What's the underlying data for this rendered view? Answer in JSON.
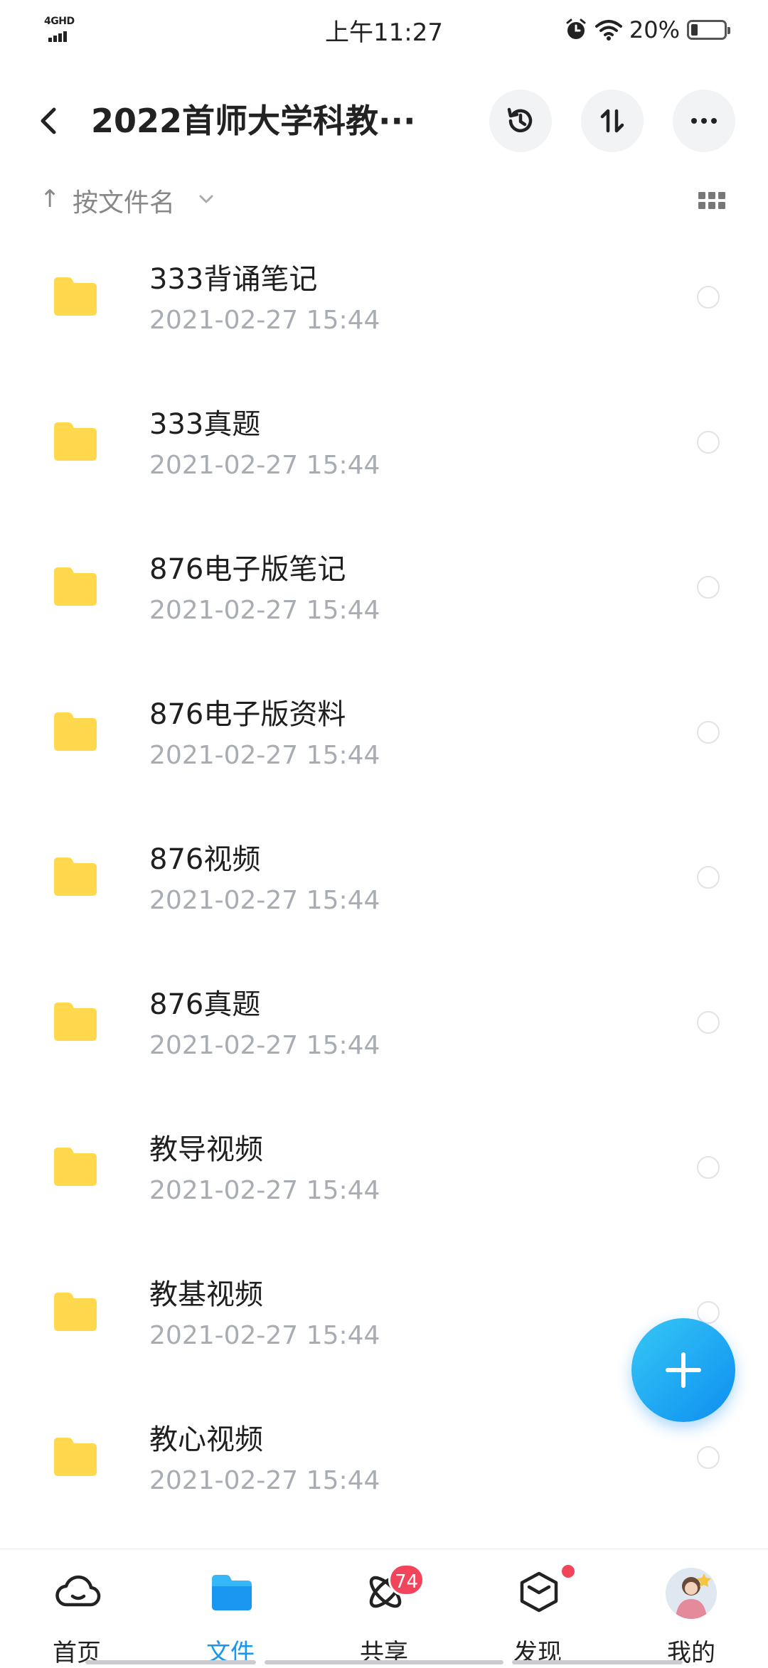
{
  "status_bar": {
    "network": "4GHD",
    "time": "上午11:27",
    "battery": "20%",
    "battery_level": 0.2
  },
  "header": {
    "title": "2022首师大学科教···",
    "back_icon": "back-arrow-icon",
    "history_icon": "history-clock-icon",
    "transfer_icon": "up-down-transfer-icon",
    "more_icon": "more-dots-icon"
  },
  "sort": {
    "label": "按文件名",
    "arrow_icon": "sort-up-arrow-icon",
    "view_icon": "grid-view-icon"
  },
  "files": [
    {
      "name": "333背诵笔记",
      "date": "2021-02-27  15:44"
    },
    {
      "name": "333真题",
      "date": "2021-02-27  15:44"
    },
    {
      "name": "876电子版笔记",
      "date": "2021-02-27  15:44"
    },
    {
      "name": "876电子版资料",
      "date": "2021-02-27  15:44"
    },
    {
      "name": "876视频",
      "date": "2021-02-27  15:44"
    },
    {
      "name": "876真题",
      "date": "2021-02-27  15:44"
    },
    {
      "name": "教导视频",
      "date": "2021-02-27  15:44"
    },
    {
      "name": "教基视频",
      "date": "2021-02-27  15:44"
    },
    {
      "name": "教心视频",
      "date": "2021-02-27  15:44"
    }
  ],
  "colors": {
    "folder": "#FFD84D",
    "accent": "#1A96F0",
    "badge": "#F2455C"
  },
  "bottom_nav": {
    "home": "首页",
    "files": "文件",
    "share": "共享",
    "share_badge": "74",
    "discover": "发现",
    "mine": "我的",
    "active": "文件"
  }
}
